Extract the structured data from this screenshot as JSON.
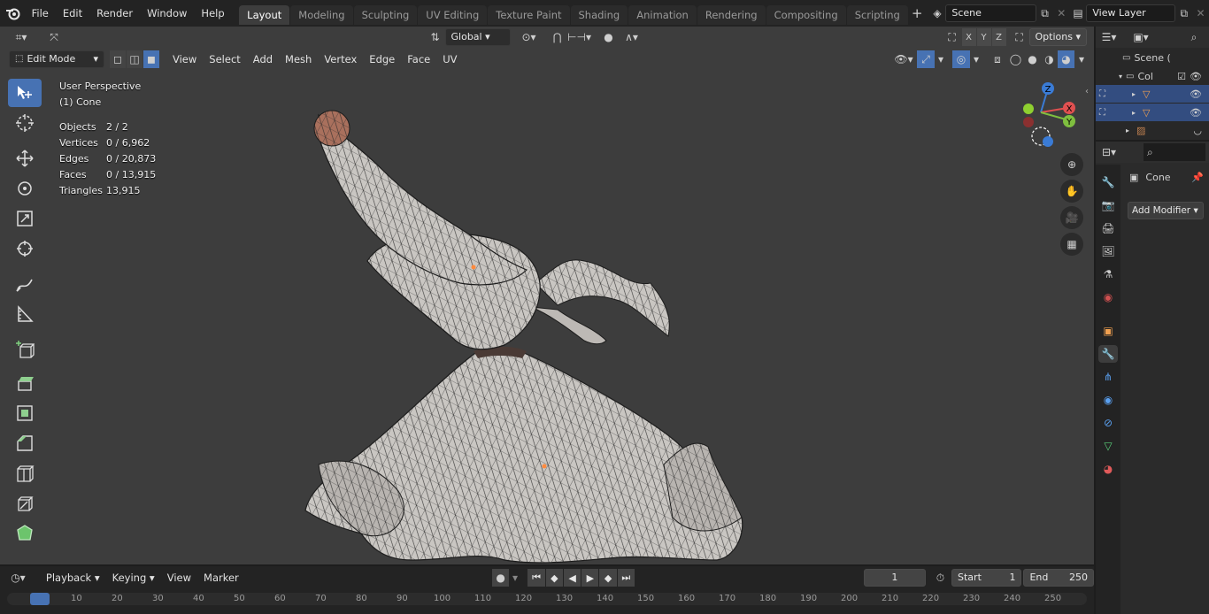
{
  "app": {
    "menus": [
      "File",
      "Edit",
      "Render",
      "Window",
      "Help"
    ],
    "workspaces": [
      "Layout",
      "Modeling",
      "Sculpting",
      "UV Editing",
      "Texture Paint",
      "Shading",
      "Animation",
      "Rendering",
      "Compositing",
      "Scripting"
    ],
    "active_workspace": "Layout",
    "scene_name": "Scene",
    "view_layer": "View Layer"
  },
  "viewport_header": {
    "transform_orientation": "Global",
    "options_label": "Options",
    "mode": "Edit Mode",
    "menus": [
      "View",
      "Select",
      "Add",
      "Mesh",
      "Vertex",
      "Edge",
      "Face",
      "UV"
    ]
  },
  "overlay": {
    "view_name": "User Perspective",
    "object_name": "(1) Cone",
    "stats": [
      {
        "label": "Objects",
        "value": "2 / 2"
      },
      {
        "label": "Vertices",
        "value": "0 / 6,962"
      },
      {
        "label": "Edges",
        "value": "0 / 20,873"
      },
      {
        "label": "Faces",
        "value": "0 / 13,915"
      },
      {
        "label": "Triangles",
        "value": "13,915"
      }
    ]
  },
  "gizmo": {
    "z": "Z",
    "x": "X",
    "y": "Y"
  },
  "outliner": {
    "scene_label": "Scene (",
    "collection_label": "Col"
  },
  "properties": {
    "object_name": "Cone",
    "add_modifier_label": "Add Modifier"
  },
  "timeline": {
    "menus": [
      "Playback",
      "Keying",
      "View",
      "Marker"
    ],
    "current_frame": "1",
    "start_label": "Start",
    "start_value": "1",
    "end_label": "End",
    "end_value": "250",
    "ticks": [
      "10",
      "20",
      "30",
      "40",
      "50",
      "60",
      "70",
      "80",
      "90",
      "100",
      "110",
      "120",
      "130",
      "140",
      "150",
      "160",
      "170",
      "180",
      "190",
      "200",
      "210",
      "220",
      "230",
      "240",
      "250"
    ]
  },
  "colors": {
    "accent": "#4772b3",
    "viewport_bg": "#3d3d3d",
    "mesh": "#c8c4c0"
  }
}
